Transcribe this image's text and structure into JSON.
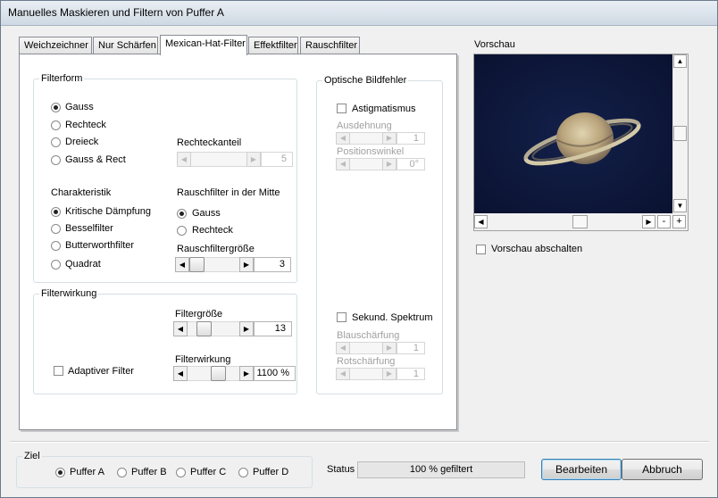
{
  "window": {
    "title": "Manuelles Maskieren und Filtern von Puffer A"
  },
  "tabs": [
    {
      "label": "Weichzeichner"
    },
    {
      "label": "Nur Schärfen"
    },
    {
      "label": "Mexican-Hat-Filter"
    },
    {
      "label": "Effektfilter"
    },
    {
      "label": "Rauschfilter"
    }
  ],
  "active_tab": "Mexican-Hat-Filter",
  "filterform": {
    "legend": "Filterform",
    "shapes": [
      {
        "label": "Gauss",
        "selected": true
      },
      {
        "label": "Rechteck",
        "selected": false
      },
      {
        "label": "Dreieck",
        "selected": false
      },
      {
        "label": "Gauss & Rect",
        "selected": false
      }
    ],
    "rechteckanteil": {
      "label": "Rechteckanteil",
      "value": "5"
    },
    "charakteristik": {
      "label": "Charakteristik",
      "options": [
        {
          "label": "Kritische Dämpfung",
          "selected": true
        },
        {
          "label": "Besselfilter",
          "selected": false
        },
        {
          "label": "Butterworthfilter",
          "selected": false
        },
        {
          "label": "Quadrat",
          "selected": false
        }
      ]
    },
    "rauschfilter_mitte": {
      "label": "Rauschfilter in der Mitte",
      "options": [
        {
          "label": "Gauss",
          "selected": true
        },
        {
          "label": "Rechteck",
          "selected": false
        }
      ]
    },
    "rauschfiltergroesse": {
      "label": "Rauschfiltergröße",
      "value": "3"
    }
  },
  "filterwirkung": {
    "legend": "Filterwirkung",
    "filtergroesse": {
      "label": "Filtergröße",
      "value": "13"
    },
    "adaptiver_filter": {
      "label": "Adaptiver Filter",
      "checked": false
    },
    "filterwirkung": {
      "label": "Filterwirkung",
      "value": "1100 %"
    }
  },
  "optische_bildfehler": {
    "legend": "Optische Bildfehler",
    "astigmatismus": {
      "label": "Astigmatismus",
      "checked": false
    },
    "ausdehnung": {
      "label": "Ausdehnung",
      "value": "1"
    },
    "positionswinkel": {
      "label": "Positionswinkel",
      "value": "0°"
    },
    "sekund_spektrum": {
      "label": "Sekund. Spektrum",
      "checked": false
    },
    "blauschaerfung": {
      "label": "Blauschärfung",
      "value": "1"
    },
    "rotschaerfung": {
      "label": "Rotschärfung",
      "value": "1"
    }
  },
  "preview": {
    "label": "Vorschau",
    "zoom_out": "-",
    "zoom_in": "+",
    "disable_label": "Vorschau abschalten",
    "disable_checked": false
  },
  "ziel": {
    "legend": "Ziel",
    "options": [
      {
        "label": "Puffer A",
        "selected": true
      },
      {
        "label": "Puffer B",
        "selected": false
      },
      {
        "label": "Puffer C",
        "selected": false
      },
      {
        "label": "Puffer D",
        "selected": false
      }
    ]
  },
  "status": {
    "label": "Status",
    "value": "100 % gefiltert"
  },
  "buttons": {
    "edit": "Bearbeiten",
    "cancel": "Abbruch"
  },
  "icons": {
    "left": "arrow-left-icon",
    "right": "arrow-right-icon",
    "up": "arrow-up-icon",
    "down": "arrow-down-icon"
  }
}
